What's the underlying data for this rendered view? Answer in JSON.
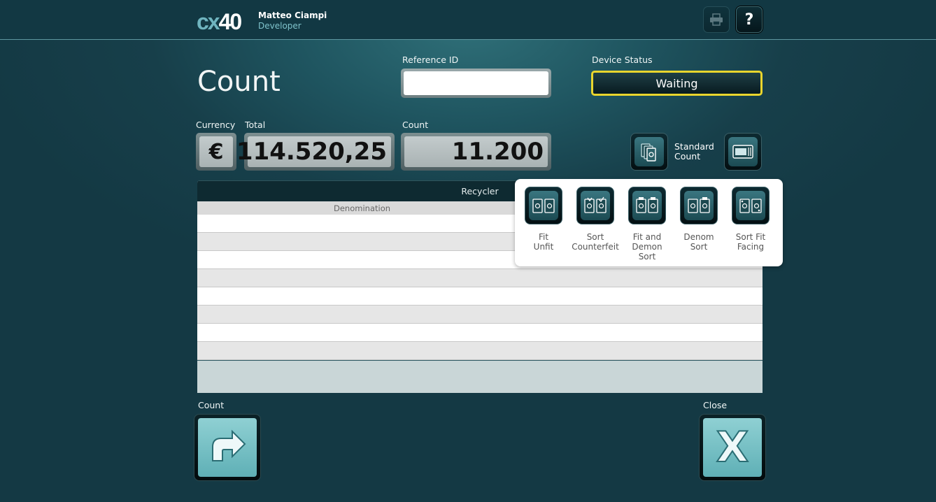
{
  "app": {
    "logo_prefix": "cx",
    "logo_number": "40",
    "user_name": "Matteo Ciampi",
    "user_role": "Developer"
  },
  "topbar": {
    "printer_icon": "printer-icon",
    "help_label": "?"
  },
  "page": {
    "title": "Count"
  },
  "reference": {
    "label": "Reference ID",
    "value": "",
    "placeholder": ""
  },
  "device": {
    "label": "Device Status",
    "status": "Waiting",
    "status_color": "#e9d52d"
  },
  "values": {
    "currency_label": "Currency",
    "currency_symbol": "€",
    "total_label": "Total",
    "total_value": "114.520,25",
    "count_label": "Count",
    "count_value": "11.200"
  },
  "mode": {
    "label": "Standard Count",
    "mode_icon": "banknote-stack-icon",
    "settings_icon": "cash-drawer-icon"
  },
  "table": {
    "title": "Recycler",
    "column_denomination": "Denomination",
    "rows": [
      {},
      {},
      {},
      {},
      {},
      {},
      {},
      {}
    ]
  },
  "popup": {
    "options": [
      {
        "label": "Fit Unfit",
        "icon": "fit-unfit-icon"
      },
      {
        "label": "Sort Counterfeit",
        "icon": "sort-counterfeit-icon"
      },
      {
        "label": "Fit and Demon Sort",
        "icon": "fit-demon-sort-icon"
      },
      {
        "label": "Denom Sort",
        "icon": "denom-sort-icon"
      },
      {
        "label": "Sort Fit Facing",
        "icon": "sort-fit-facing-icon"
      }
    ]
  },
  "actions": {
    "count_label": "Count",
    "count_icon": "return-arrow-icon",
    "close_label": "Close",
    "close_symbol": "X"
  },
  "colors": {
    "accent": "#6fb4bf",
    "button_face": "#7cc3c7"
  }
}
